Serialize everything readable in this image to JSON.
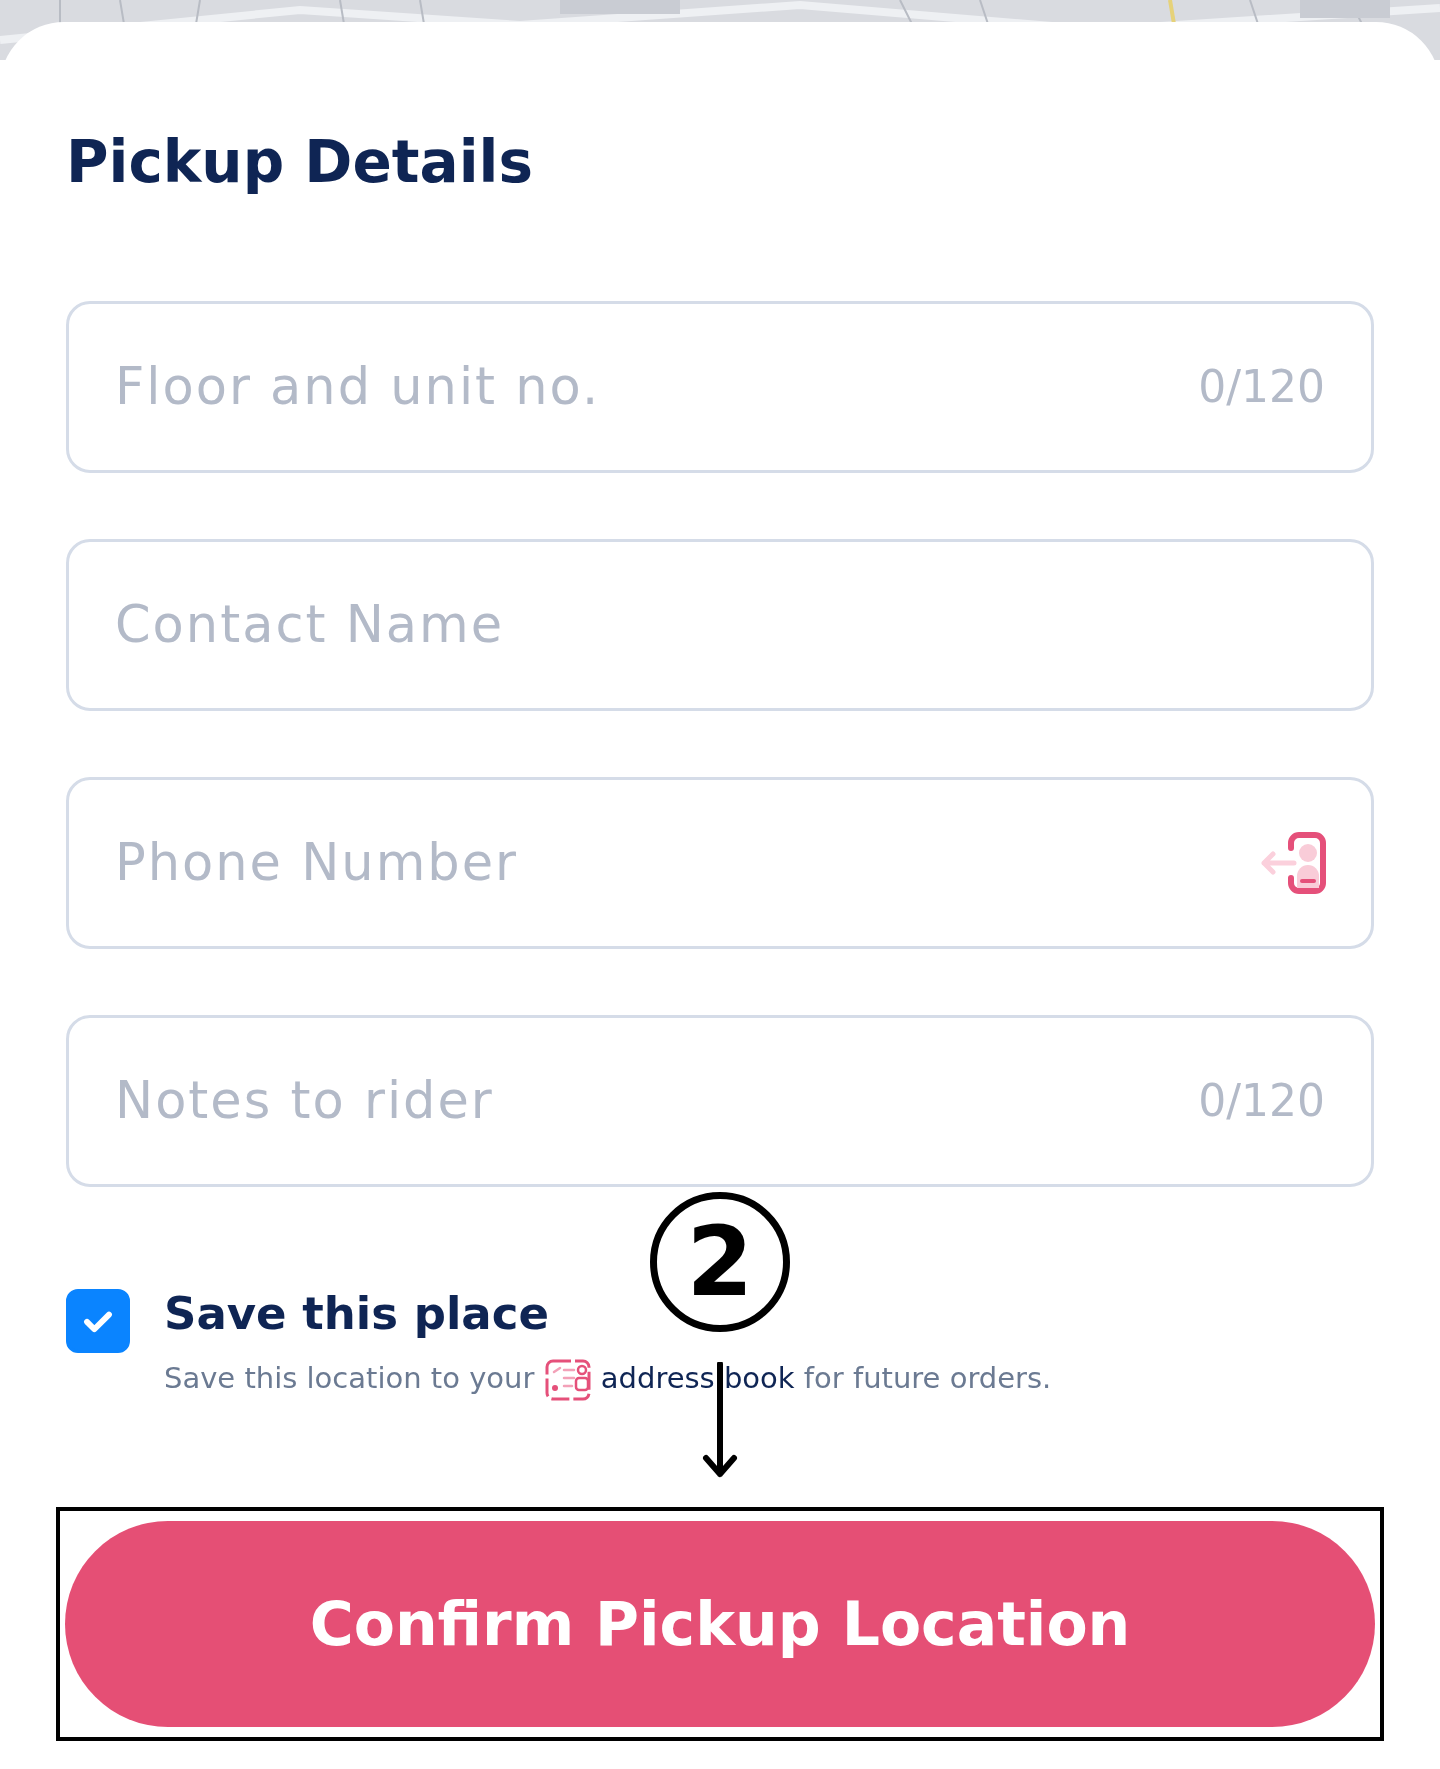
{
  "title": "Pickup Details",
  "fields": [
    {
      "kind": "counter",
      "placeholder": "Floor and unit no.",
      "counter": "0/120"
    },
    {
      "kind": "plain",
      "placeholder": "Contact Name"
    },
    {
      "kind": "contact",
      "placeholder": "Phone Number"
    },
    {
      "kind": "counter",
      "placeholder": "Notes to rider",
      "counter": "0/120"
    }
  ],
  "save_place": {
    "checked": true,
    "label": "Save this place",
    "description_before": "Save this location to your",
    "link": "address book",
    "description_after": "for future orders."
  },
  "annotation": {
    "label": "2"
  },
  "confirm_button": "Confirm Pickup Location"
}
